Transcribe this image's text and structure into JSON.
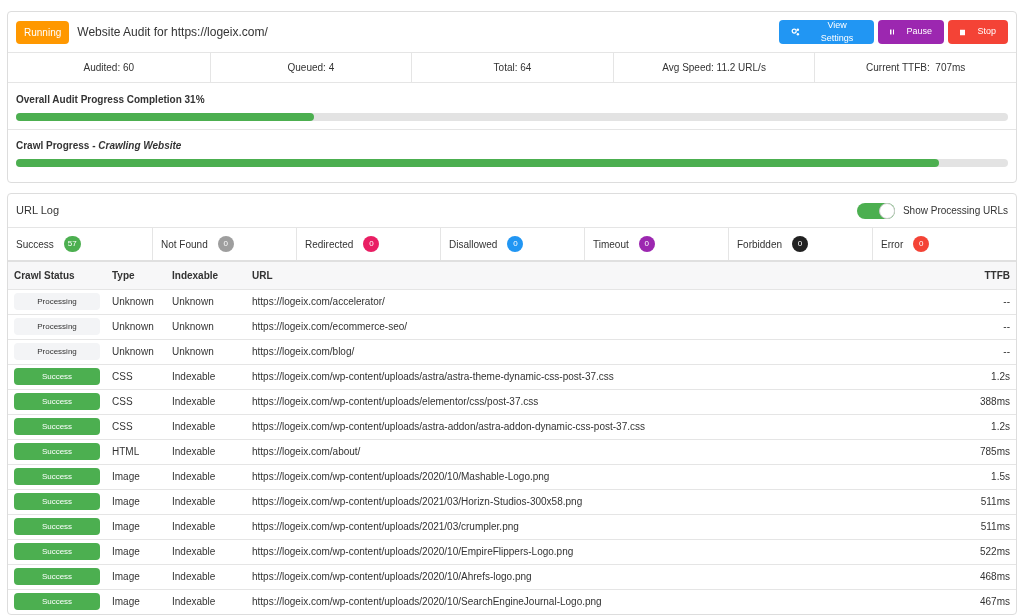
{
  "audit": {
    "status": "Running",
    "title": "Website Audit for https://logeix.com/",
    "buttons": [
      {
        "kind": "settings",
        "label": "View Settings"
      },
      {
        "kind": "pause",
        "label": "Pause"
      },
      {
        "kind": "stop",
        "label": "Stop"
      }
    ]
  },
  "stats": [
    "Audited: 60",
    "Queued: 4",
    "Total: 64",
    "Avg Speed: 11.2 URL/s",
    "Current TTFB:  707ms"
  ],
  "progress": [
    {
      "label": "Overall Audit Progress Completion 31%",
      "level": 0.3
    },
    {
      "label": "Crawl Progress - *Crawling Website*",
      "level": 0.93
    }
  ],
  "url_log": {
    "title": "URL Log",
    "toggle": {
      "label": "Show Processing URLs",
      "on": true
    },
    "filters": [
      {
        "label": "Success",
        "count": "57",
        "color": "#4caf50"
      },
      {
        "label": "Not Found",
        "count": "0",
        "color": "#9e9e9e"
      },
      {
        "label": "Redirected",
        "count": "0",
        "color": "#e91e63"
      },
      {
        "label": "Disallowed",
        "count": "0",
        "color": "#2196f3"
      },
      {
        "label": "Timeout",
        "count": "0",
        "color": "#9c27b0"
      },
      {
        "label": "Forbidden",
        "count": "0",
        "color": "#212121"
      },
      {
        "label": "Error",
        "count": "0",
        "color": "#f44336"
      }
    ],
    "columns": [
      "Crawl Status",
      "Type",
      "Indexable",
      "URL",
      "TTFB"
    ],
    "rows": [
      {
        "status": "Processing",
        "kind": "processing",
        "type": "Unknown",
        "indexable": "Unknown",
        "url": "https://logeix.com/accelerator/",
        "ttfb": "--"
      },
      {
        "status": "Processing",
        "kind": "processing",
        "type": "Unknown",
        "indexable": "Unknown",
        "url": "https://logeix.com/ecommerce-seo/",
        "ttfb": "--"
      },
      {
        "status": "Processing",
        "kind": "processing",
        "type": "Unknown",
        "indexable": "Unknown",
        "url": "https://logeix.com/blog/",
        "ttfb": "--"
      },
      {
        "status": "Success",
        "kind": "success",
        "type": "CSS",
        "indexable": "Indexable",
        "url": "https://logeix.com/wp-content/uploads/astra/astra-theme-dynamic-css-post-37.css",
        "ttfb": "1.2s"
      },
      {
        "status": "Success",
        "kind": "success",
        "type": "CSS",
        "indexable": "Indexable",
        "url": "https://logeix.com/wp-content/uploads/elementor/css/post-37.css",
        "ttfb": "388ms"
      },
      {
        "status": "Success",
        "kind": "success",
        "type": "CSS",
        "indexable": "Indexable",
        "url": "https://logeix.com/wp-content/uploads/astra-addon/astra-addon-dynamic-css-post-37.css",
        "ttfb": "1.2s"
      },
      {
        "status": "Success",
        "kind": "success",
        "type": "HTML",
        "indexable": "Indexable",
        "url": "https://logeix.com/about/",
        "ttfb": "785ms"
      },
      {
        "status": "Success",
        "kind": "success",
        "type": "Image",
        "indexable": "Indexable",
        "url": "https://logeix.com/wp-content/uploads/2020/10/Mashable-Logo.png",
        "ttfb": "1.5s"
      },
      {
        "status": "Success",
        "kind": "success",
        "type": "Image",
        "indexable": "Indexable",
        "url": "https://logeix.com/wp-content/uploads/2021/03/Horizn-Studios-300x58.png",
        "ttfb": "511ms"
      },
      {
        "status": "Success",
        "kind": "success",
        "type": "Image",
        "indexable": "Indexable",
        "url": "https://logeix.com/wp-content/uploads/2021/03/crumpler.png",
        "ttfb": "511ms"
      },
      {
        "status": "Success",
        "kind": "success",
        "type": "Image",
        "indexable": "Indexable",
        "url": "https://logeix.com/wp-content/uploads/2020/10/EmpireFlippers-Logo.png",
        "ttfb": "522ms"
      },
      {
        "status": "Success",
        "kind": "success",
        "type": "Image",
        "indexable": "Indexable",
        "url": "https://logeix.com/wp-content/uploads/2020/10/Ahrefs-logo.png",
        "ttfb": "468ms"
      },
      {
        "status": "Success",
        "kind": "success",
        "type": "Image",
        "indexable": "Indexable",
        "url": "https://logeix.com/wp-content/uploads/2020/10/SearchEngineJournal-Logo.png",
        "ttfb": "467ms"
      }
    ]
  }
}
